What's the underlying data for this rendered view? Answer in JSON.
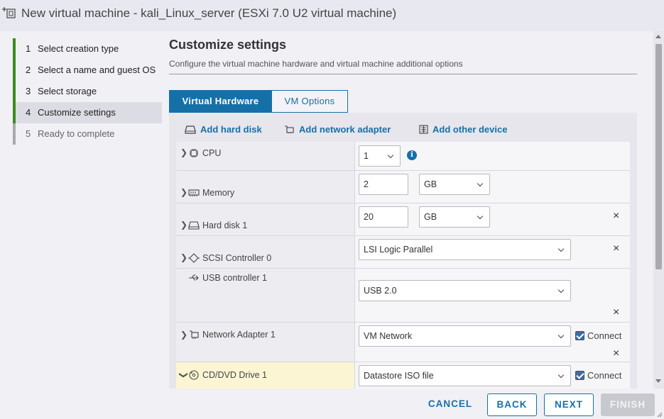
{
  "window": {
    "title": "New virtual machine - kali_Linux_server (ESXi 7.0 U2 virtual machine)",
    "icon": "add-vm-icon"
  },
  "wizard": {
    "steps": [
      {
        "num": "1",
        "label": "Select creation type",
        "state": "done"
      },
      {
        "num": "2",
        "label": "Select a name and guest OS",
        "state": "done"
      },
      {
        "num": "3",
        "label": "Select storage",
        "state": "done"
      },
      {
        "num": "4",
        "label": "Customize settings",
        "state": "active"
      },
      {
        "num": "5",
        "label": "Ready to complete",
        "state": "pending"
      }
    ]
  },
  "main": {
    "title": "Customize settings",
    "subtitle": "Configure the virtual machine hardware and virtual machine additional options",
    "tabs": [
      {
        "label": "Virtual Hardware",
        "selected": true
      },
      {
        "label": "VM Options",
        "selected": false
      }
    ],
    "actions": {
      "add_hard_disk": "Add hard disk",
      "add_network_adapter": "Add network adapter",
      "add_other_device": "Add other device"
    },
    "devices": {
      "cpu": {
        "label": "CPU",
        "value": "1"
      },
      "memory": {
        "label": "Memory",
        "value": "2",
        "unit": "GB"
      },
      "hard_disk": {
        "label": "Hard disk 1",
        "value": "20",
        "unit": "GB"
      },
      "scsi": {
        "label": "SCSI Controller 0",
        "value": "LSI Logic Parallel"
      },
      "usb": {
        "label": "USB controller 1",
        "value": "USB 2.0"
      },
      "network": {
        "label": "Network Adapter 1",
        "value": "VM Network",
        "connect_label": "Connect",
        "connected": true
      },
      "cd_dvd": {
        "label": "CD/DVD Drive 1",
        "value": "Datastore ISO file",
        "connect_label": "Connect",
        "connected": true
      }
    }
  },
  "footer": {
    "cancel": "CANCEL",
    "back": "BACK",
    "next": "NEXT",
    "finish": "FINISH"
  },
  "colors": {
    "accent": "#1670a8",
    "step_done": "#3b8d1f",
    "cd_highlight": "#fbf5d3"
  }
}
